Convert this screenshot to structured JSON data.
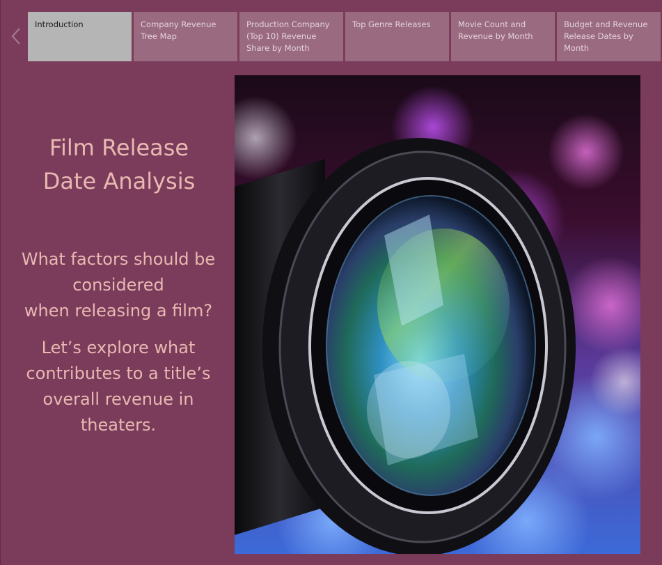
{
  "nav": {
    "back_icon": "chevron-left-icon",
    "tabs": [
      {
        "label": "Introduction",
        "active": true
      },
      {
        "label": "Company Revenue Tree Map",
        "active": false
      },
      {
        "label": "Production Company (Top 10) Revenue Share by Month",
        "active": false
      },
      {
        "label": "Top Genre Releases",
        "active": false
      },
      {
        "label": "Movie Count and Revenue by Month",
        "active": false
      },
      {
        "label": "Budget and Revenue Release Dates by Month",
        "active": false
      }
    ]
  },
  "content": {
    "title_line1": "Film Release",
    "title_line2": "Date Analysis",
    "question_line1": "What factors should be",
    "question_line2": "considered",
    "question_line3": "when releasing a film?",
    "explore_line1": "Let’s explore what",
    "explore_line2": "contributes to a title’s",
    "explore_line3": "overall revenue in",
    "explore_line4": "theaters."
  },
  "colors": {
    "background": "#7a3c5a",
    "tab_inactive": "#9a6b80",
    "tab_active": "#b5b5b5",
    "heading_text": "#e8b8b2"
  }
}
